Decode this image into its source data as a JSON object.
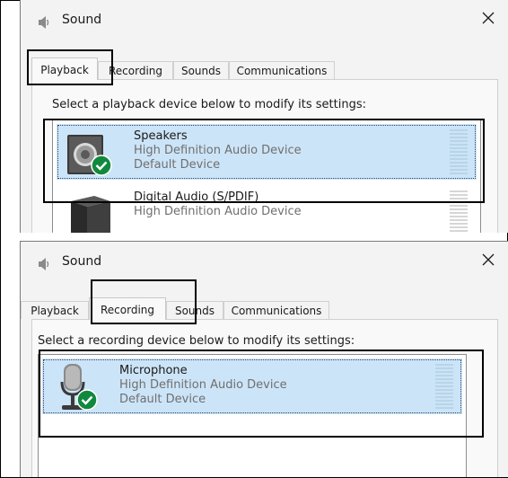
{
  "playback_window": {
    "title": "Sound",
    "tabs": [
      {
        "label": "Playback",
        "active": true
      },
      {
        "label": "Recording",
        "active": false
      },
      {
        "label": "Sounds",
        "active": false
      },
      {
        "label": "Communications",
        "active": false
      }
    ],
    "instruction": "Select a playback device below to modify its settings:",
    "devices": [
      {
        "name": "Speakers",
        "description": "High Definition Audio Device",
        "status": "Default Device",
        "icon": "speaker-icon",
        "selected": true
      },
      {
        "name": "Digital Audio (S/PDIF)",
        "description": "High Definition Audio Device",
        "status": "",
        "icon": "digital-audio-icon",
        "selected": false
      }
    ]
  },
  "recording_window": {
    "title": "Sound",
    "tabs": [
      {
        "label": "Playback",
        "active": false
      },
      {
        "label": "Recording",
        "active": true
      },
      {
        "label": "Sounds",
        "active": false
      },
      {
        "label": "Communications",
        "active": false
      }
    ],
    "instruction": "Select a recording device below to modify its settings:",
    "devices": [
      {
        "name": "Microphone",
        "description": "High Definition Audio Device",
        "status": "Default Device",
        "icon": "microphone-icon",
        "selected": true
      }
    ]
  },
  "colors": {
    "selection": "#cce4f7",
    "default_badge": "#10893e",
    "highlight_box": "#000000"
  }
}
